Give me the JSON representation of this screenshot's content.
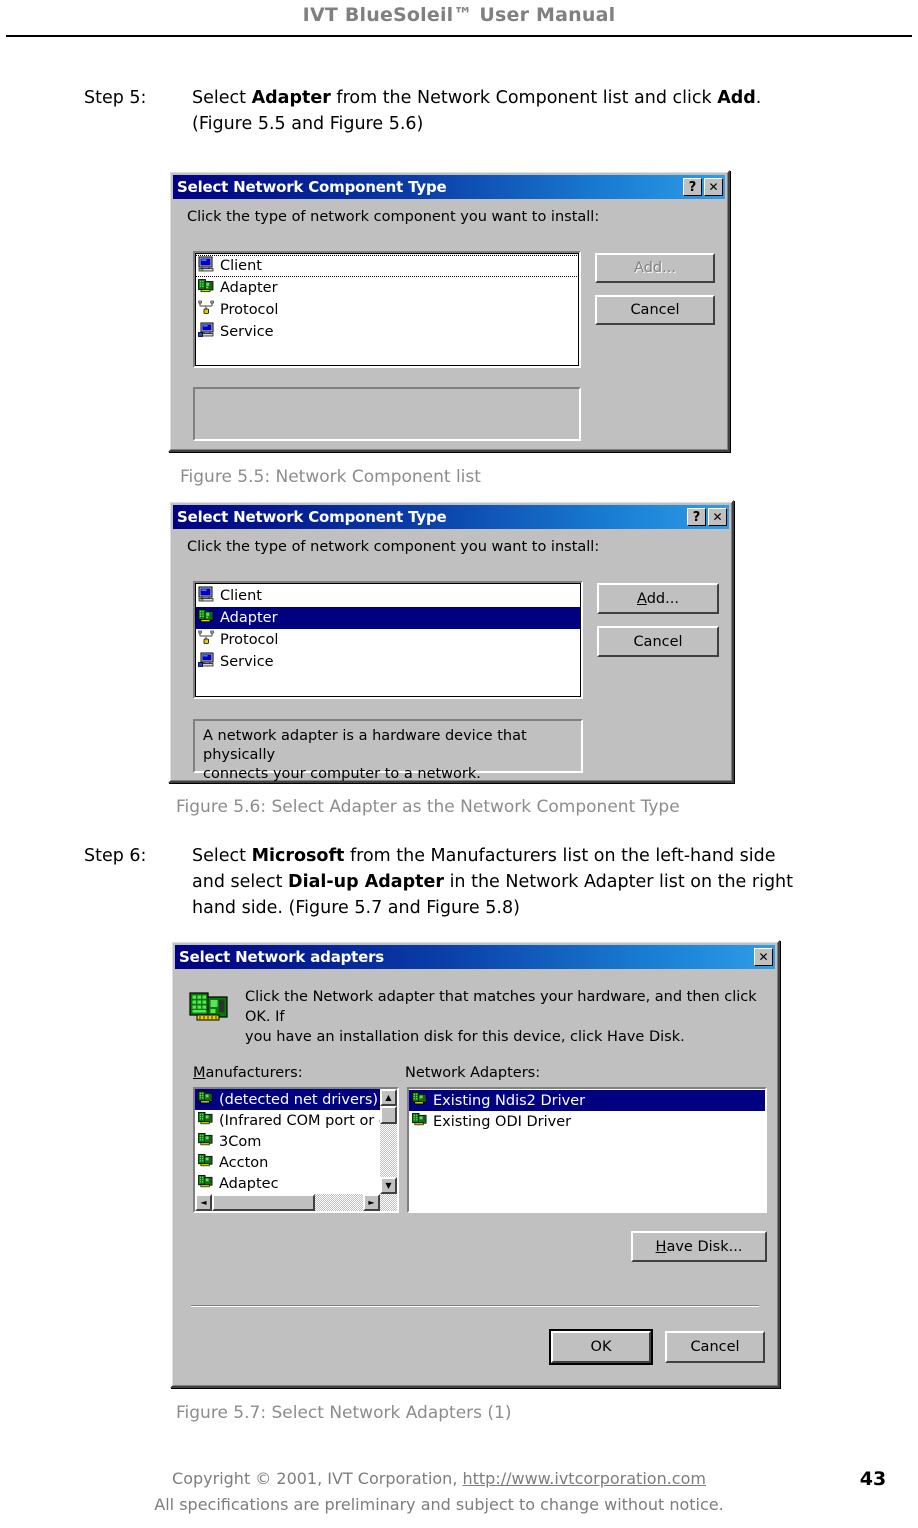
{
  "header": {
    "title": "IVT BlueSoleil™ User Manual"
  },
  "steps": [
    {
      "label": "Step 5:",
      "line1_pre": "Select ",
      "line1_bold1": "Adapter",
      "line1_mid": " from the Network Component list and click ",
      "line1_bold2": "Add",
      "line1_post": ".",
      "line2": "(Figure 5.5 and Figure 5.6)"
    },
    {
      "label": "Step 6:",
      "line1_pre": "Select ",
      "line1_bold1": "Microsoft",
      "line1_mid": " from the Manufacturers list on the left-hand side",
      "line2_pre": "and select ",
      "line2_bold": "Dial-up Adapter",
      "line2_post": " in the Network Adapter list on the right",
      "line3": "hand side. (Figure 5.7 and Figure 5.8)"
    }
  ],
  "captions": {
    "fig55": "Figure 5.5: Network Component list",
    "fig56": "Figure 5.6: Select Adapter as the Network Component Type",
    "fig57": "Figure 5.7: Select Network Adapters (1)"
  },
  "dialog1": {
    "title": "Select Network Component Type",
    "help_button": "?",
    "close_button": "✕",
    "prompt": "Click the type of network component you want to install:",
    "items": [
      {
        "label": "Client",
        "icon": "monitor-client-icon",
        "selected": false,
        "focused": true
      },
      {
        "label": "Adapter",
        "icon": "network-card-icon",
        "selected": false,
        "focused": false
      },
      {
        "label": "Protocol",
        "icon": "protocol-pipe-icon",
        "selected": false,
        "focused": false
      },
      {
        "label": "Service",
        "icon": "monitor-service-icon",
        "selected": false,
        "focused": false
      }
    ],
    "description": "",
    "add_button": "Add...",
    "add_enabled": false,
    "cancel_button": "Cancel"
  },
  "dialog2": {
    "title": "Select Network Component Type",
    "help_button": "?",
    "close_button": "✕",
    "prompt": "Click the type of network component you want to install:",
    "items": [
      {
        "label": "Client",
        "icon": "monitor-client-icon",
        "selected": false
      },
      {
        "label": "Adapter",
        "icon": "network-card-icon",
        "selected": true
      },
      {
        "label": "Protocol",
        "icon": "protocol-pipe-icon",
        "selected": false
      },
      {
        "label": "Service",
        "icon": "monitor-service-icon",
        "selected": false
      }
    ],
    "description_line1": "A network adapter is a hardware device that physically",
    "description_line2": "connects your computer to a network.",
    "add_button_pre": "A",
    "add_button_post": "dd...",
    "add_enabled": true,
    "cancel_button": "Cancel"
  },
  "dialog3": {
    "title": "Select Network adapters",
    "close_button": "✕",
    "info_line1": "Click the Network adapter that matches your hardware, and then click OK. If",
    "info_line2": "you have an installation disk for this device, click Have Disk.",
    "manufacturers_label_pre": "M",
    "manufacturers_label_post": "anufacturers:",
    "adapters_label": "Network Adapters:",
    "manufacturers": [
      {
        "label": "(detected net drivers)",
        "selected": true
      },
      {
        "label": "(Infrared COM port or do",
        "selected": false
      },
      {
        "label": "3Com",
        "selected": false
      },
      {
        "label": "Accton",
        "selected": false
      },
      {
        "label": "Adaptec",
        "selected": false
      }
    ],
    "adapters": [
      {
        "label": "Existing Ndis2 Driver",
        "selected": true
      },
      {
        "label": "Existing ODI Driver",
        "selected": false
      }
    ],
    "have_disk_pre": "H",
    "have_disk_post": "ave Disk...",
    "ok_button": "OK",
    "cancel_button": "Cancel",
    "scroll_up_glyph": "▲",
    "scroll_down_glyph": "▼",
    "scroll_left_glyph": "◄",
    "scroll_right_glyph": "►"
  },
  "footer": {
    "copyright_pre": "Copyright © 2001, IVT Corporation, ",
    "copyright_link": "http://www.ivtcorporation.com",
    "disclaimer": "All specifications are preliminary and subject to change without notice.",
    "page_number": "43"
  },
  "colors": {
    "titlebar_start": "#000080",
    "titlebar_end": "#2f9de8",
    "selection": "#000080",
    "dialog_face": "#c0c0c0",
    "caption_gray": "#8c8c8c",
    "header_gray": "#808080"
  }
}
